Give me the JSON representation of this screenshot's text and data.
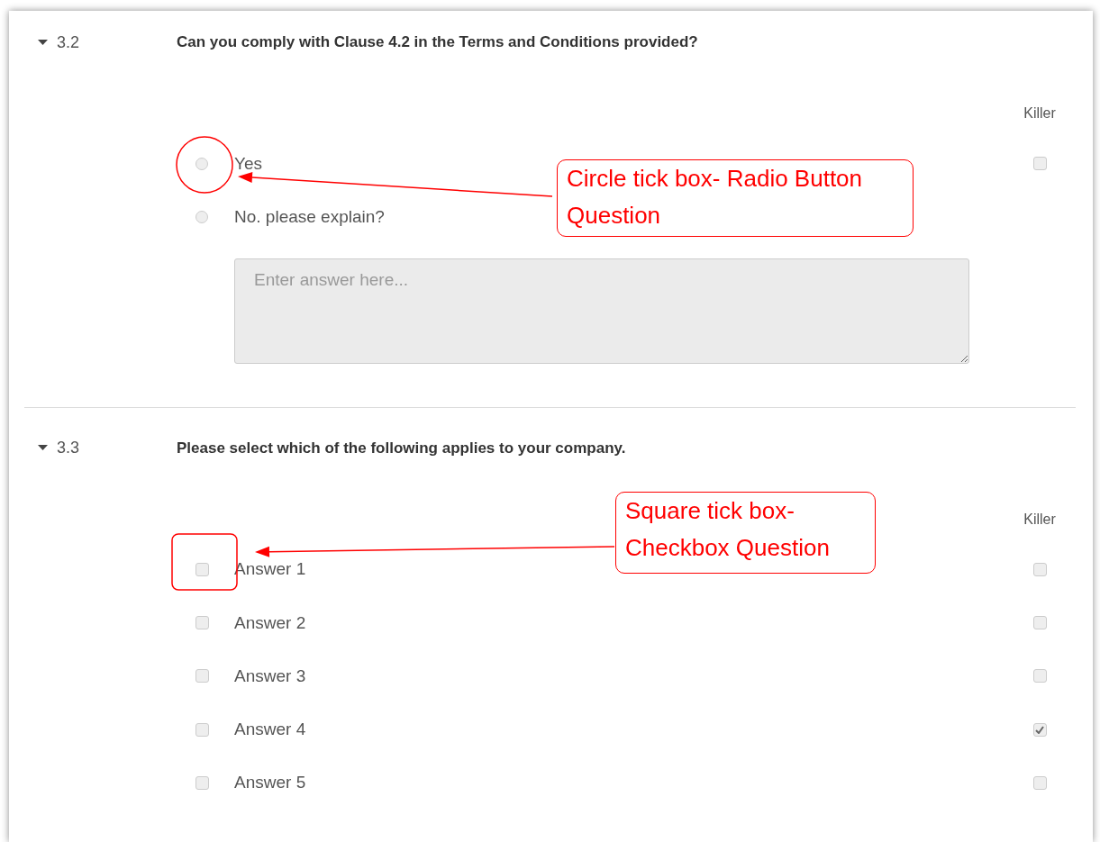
{
  "questions": [
    {
      "number": "3.2",
      "kind": "radio",
      "text": "Can you comply with Clause 4.2 in the Terms and Conditions provided?",
      "expanded": true,
      "killer_label": "Killer",
      "killer": {
        "checked": false
      },
      "options": [
        {
          "label": "Yes",
          "selected": false
        },
        {
          "label": "No. please explain?",
          "selected": false
        }
      ],
      "answer_box": {
        "placeholder": "Enter answer here..."
      }
    },
    {
      "number": "3.3",
      "kind": "checkbox",
      "text": "Please select which of the following applies to your company.",
      "expanded": true,
      "killer_label": "Killer",
      "options": [
        {
          "label": "Answer 1",
          "checked": false,
          "killer": false
        },
        {
          "label": "Answer 2",
          "checked": false,
          "killer": false
        },
        {
          "label": "Answer 3",
          "checked": false,
          "killer": false
        },
        {
          "label": "Answer 4",
          "checked": false,
          "killer": true
        },
        {
          "label": "Answer 5",
          "checked": false,
          "killer": false
        }
      ]
    }
  ],
  "annotations": [
    {
      "kind": "circle",
      "text": "Circle tick box- Radio Button Question"
    },
    {
      "kind": "square",
      "text": "Square tick box-Checkbox Question"
    }
  ]
}
